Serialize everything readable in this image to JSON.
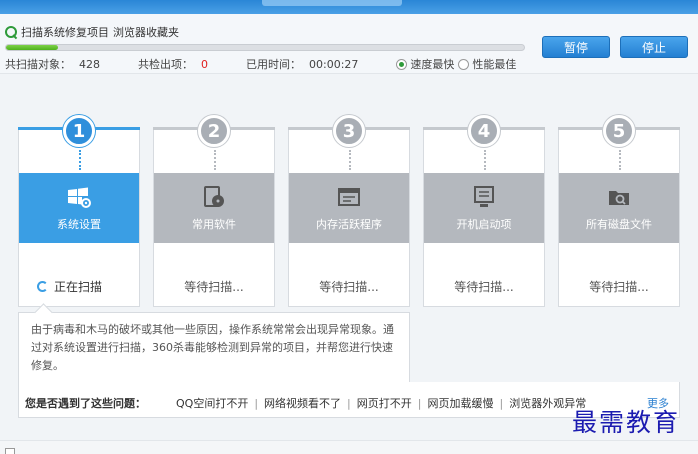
{
  "header": {
    "scan_items": [
      "扫描系统修复项目",
      "浏览器收藏夹"
    ],
    "progress_fraction": 0.1,
    "stats": {
      "scanned_label": "共扫描对象：",
      "scanned_value": "428",
      "found_label": "共检出项：",
      "found_value": "0",
      "time_label": "已用时间：",
      "time_value": "00:00:27"
    },
    "modes": [
      {
        "label": "速度最快",
        "selected": true
      },
      {
        "label": "性能最佳",
        "selected": false
      }
    ],
    "pause_label": "暂停",
    "stop_label": "停止"
  },
  "steps": [
    {
      "number": "1",
      "label": "系统设置",
      "status": "正在扫描",
      "icon": "windows-gear-icon",
      "active": true
    },
    {
      "number": "2",
      "label": "常用软件",
      "status": "等待扫描...",
      "icon": "software-box-icon",
      "active": false
    },
    {
      "number": "3",
      "label": "内存活跃程序",
      "status": "等待扫描...",
      "icon": "memory-window-icon",
      "active": false
    },
    {
      "number": "4",
      "label": "开机启动项",
      "status": "等待扫描...",
      "icon": "startup-monitor-icon",
      "active": false
    },
    {
      "number": "5",
      "label": "所有磁盘文件",
      "status": "等待扫描...",
      "icon": "disk-folder-search-icon",
      "active": false
    }
  ],
  "description": "由于病毒和木马的破坏或其他一些原因，操作系统常常会出现异常现象。通过对系统设置进行扫描，360杀毒能够检测到异常的项目，并帮您进行快速修复。",
  "issues": {
    "heading": "您是否遇到了这些问题：",
    "items": [
      "QQ空间打不开",
      "网络视频看不了",
      "网页打不开",
      "网页加载缓慢",
      "浏览器外观异常"
    ],
    "more_label": "更多"
  },
  "watermark": "最需教育",
  "colors": {
    "accent": "#3a9ee4",
    "progress": "#4fb21d",
    "found_count": "#e02020"
  }
}
